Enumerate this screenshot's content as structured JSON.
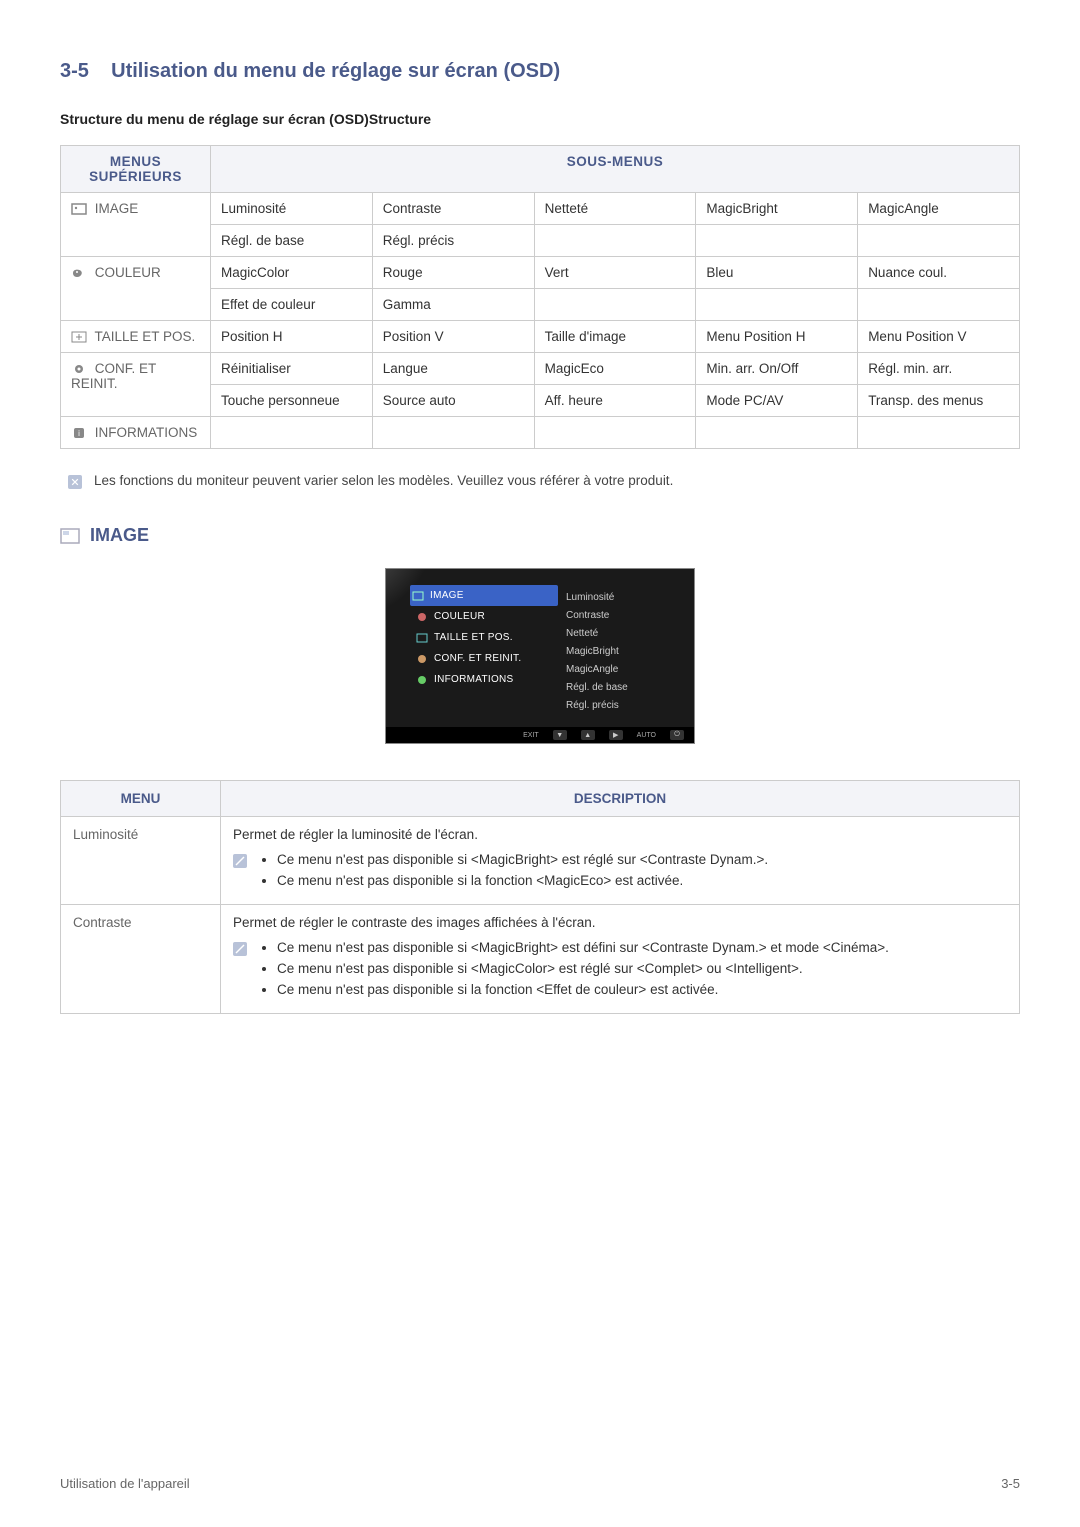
{
  "heading": {
    "number": "3-5",
    "title": "Utilisation du menu de réglage sur écran (OSD)"
  },
  "structure_title": "Structure du menu de réglage sur écran (OSD)Structure",
  "table_headers": {
    "menus_sup": "MENUS SUPÉRIEURS",
    "sous_menus": "SOUS-MENUS"
  },
  "menus": {
    "image": {
      "label": "IMAGE",
      "row1": [
        "Luminosité",
        "Contraste",
        "Netteté",
        "MagicBright",
        "MagicAngle"
      ],
      "row2": [
        "Régl. de base",
        "Régl. précis",
        "",
        "",
        ""
      ]
    },
    "couleur": {
      "label": "COULEUR",
      "row1": [
        "MagicColor",
        "Rouge",
        "Vert",
        "Bleu",
        "Nuance coul."
      ],
      "row2": [
        "Effet de couleur",
        "Gamma",
        "",
        "",
        ""
      ]
    },
    "taille": {
      "label": "TAILLE ET POS.",
      "row1": [
        "Position H",
        "Position V",
        "Taille d'image",
        "Menu Position H",
        "Menu Position V"
      ]
    },
    "conf": {
      "label": "CONF. ET REINIT.",
      "row1": [
        "Réinitialiser",
        "Langue",
        "MagicEco",
        "Min. arr. On/Off",
        "Régl. min. arr."
      ],
      "row2": [
        "Touche personneue",
        "Source auto",
        "Aff. heure",
        "Mode PC/AV",
        "Transp. des menus"
      ]
    },
    "info": {
      "label": "INFORMATIONS",
      "row1": [
        "",
        "",
        "",
        "",
        ""
      ]
    }
  },
  "note": "Les fonctions du moniteur peuvent varier selon les modèles. Veuillez vous référer à votre produit.",
  "image_section": {
    "title": "IMAGE",
    "osd_left": [
      "IMAGE",
      "COULEUR",
      "TAILLE ET POS.",
      "CONF. ET REINIT.",
      "INFORMATIONS"
    ],
    "osd_right": [
      "Luminosité",
      "Contraste",
      "Netteté",
      "MagicBright",
      "MagicAngle",
      "Régl. de base",
      "Régl. précis"
    ],
    "osd_footer": {
      "exit": "EXIT",
      "auto": "AUTO"
    }
  },
  "desc_table": {
    "headers": {
      "menu": "MENU",
      "description": "DESCRIPTION"
    },
    "rows": [
      {
        "menu": "Luminosité",
        "intro": "Permet de régler la luminosité de l'écran.",
        "bullets": [
          "Ce menu n'est pas disponible si <MagicBright> est réglé sur <Contraste Dynam.>.",
          "Ce menu n'est pas disponible si la fonction <MagicEco> est activée."
        ]
      },
      {
        "menu": "Contraste",
        "intro": "Permet de régler le contraste des images affichées à l'écran.",
        "bullets": [
          "Ce menu n'est pas disponible si <MagicBright> est défini sur <Contraste Dynam.> et mode <Cinéma>.",
          "Ce menu n'est pas disponible si <MagicColor> est réglé sur <Complet> ou <Intelligent>.",
          "Ce menu n'est pas disponible si la fonction <Effet de couleur> est activée."
        ]
      }
    ]
  },
  "footer": {
    "left": "Utilisation de l'appareil",
    "right": "3-5"
  }
}
